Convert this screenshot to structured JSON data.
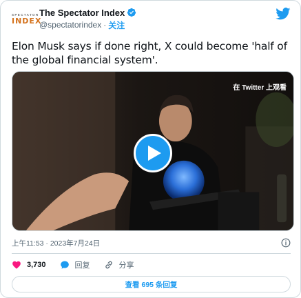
{
  "header": {
    "avatar": {
      "line1": "SPECTATOR",
      "line2": "INDEX"
    },
    "display_name": "The Spectator Index",
    "handle": "@spectatorindex",
    "separator": "·",
    "follow_label": "关注"
  },
  "tweet": {
    "text": "Elon Musk says if done right, X could become 'half of the global financial system'."
  },
  "media": {
    "watch_label": "在 Twitter 上观看"
  },
  "meta": {
    "timestamp": "上午11:53 · 2023年7月24日"
  },
  "actions": {
    "like_count": "3,730",
    "reply_label": "回复",
    "share_label": "分享"
  },
  "footer": {
    "replies_label": "查看 695 条回复"
  },
  "colors": {
    "accent": "#1d9bf0",
    "like": "#f91880",
    "text": "#0f1419",
    "muted": "#536471"
  }
}
